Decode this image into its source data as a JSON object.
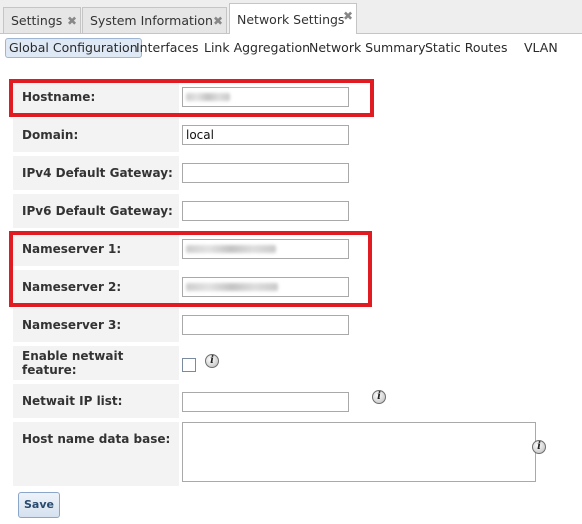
{
  "tabs": [
    {
      "label": "Settings"
    },
    {
      "label": "System Information"
    },
    {
      "label": "Network Settings",
      "active": true
    }
  ],
  "tab_close_glyph": "✖",
  "subtabs": [
    {
      "label": "Global Configuration",
      "active": true
    },
    {
      "label": "Interfaces"
    },
    {
      "label": "Link Aggregation"
    },
    {
      "label": "Network Summary"
    },
    {
      "label": "Static Routes"
    },
    {
      "label": "VLAN"
    }
  ],
  "form": {
    "hostname": {
      "label": "Hostname:",
      "value": ""
    },
    "domain": {
      "label": "Domain:",
      "value": "local"
    },
    "ipv4_gateway": {
      "label": "IPv4 Default Gateway:",
      "value": ""
    },
    "ipv6_gateway": {
      "label": "IPv6 Default Gateway:",
      "value": ""
    },
    "nameserver1": {
      "label": "Nameserver 1:",
      "value": ""
    },
    "nameserver2": {
      "label": "Nameserver 2:",
      "value": ""
    },
    "nameserver3": {
      "label": "Nameserver 3:",
      "value": ""
    },
    "netwait": {
      "label": "Enable netwait feature:",
      "checked": false
    },
    "netwait_ip": {
      "label": "Netwait IP list:",
      "value": ""
    },
    "host_db": {
      "label": "Host name data base:",
      "value": ""
    }
  },
  "info_glyph": "i",
  "save_label": "Save",
  "colors": {
    "highlight": "#e11b22",
    "active_subtab_bg": "#dfe9f5",
    "label_bg": "#f3f3f3"
  }
}
